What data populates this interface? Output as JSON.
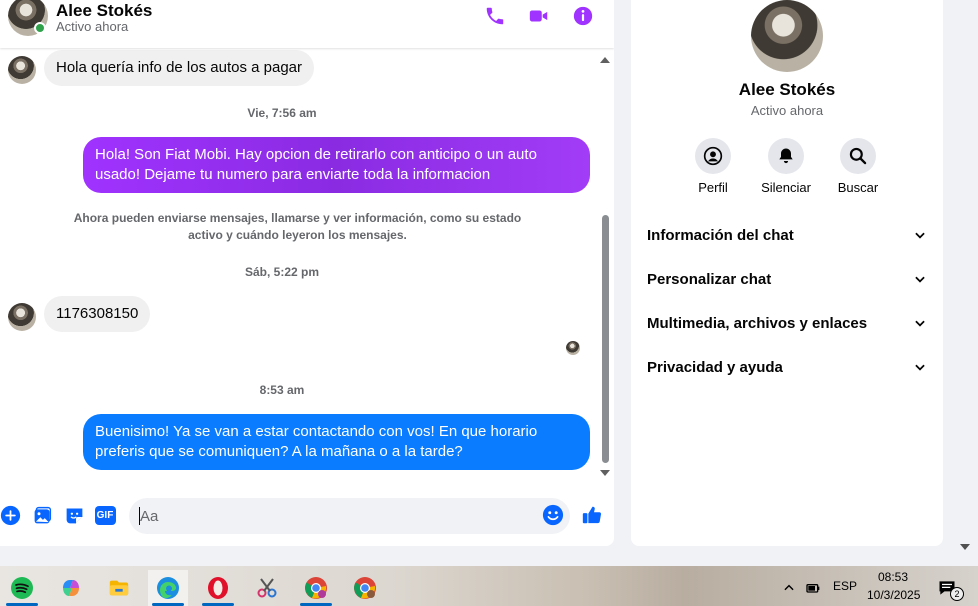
{
  "header": {
    "name": "Alee Stokés",
    "status": "Activo ahora"
  },
  "messages": [
    {
      "type": "incoming",
      "text": "Hola quería info de los autos a pagar"
    },
    {
      "type": "time",
      "text": "Vie, 7:56 am"
    },
    {
      "type": "outgoing",
      "text": "Hola! Son Fiat Mobi. Hay opcion de retirarlo con anticipo o un auto usado! Dejame tu numero para enviarte toda la informacion"
    },
    {
      "type": "notice",
      "text": "Ahora pueden enviarse mensajes, llamarse y ver información, como su estado activo y cuándo leyeron los mensajes."
    },
    {
      "type": "time",
      "text": "Sáb, 5:22 pm"
    },
    {
      "type": "incoming",
      "text": "1176308150"
    },
    {
      "type": "time",
      "text": "8:53 am"
    },
    {
      "type": "outgoing",
      "text": "Buenisimo! Ya se van a estar contactando con vos! En que horario preferis que se comuniquen? A la mañana o a la tarde?"
    }
  ],
  "composer": {
    "placeholder": "Aa",
    "gif_label": "GIF"
  },
  "info_panel": {
    "name": "Alee Stokés",
    "status": "Activo ahora",
    "actions": [
      {
        "label": "Perfil",
        "icon": "profile-icon"
      },
      {
        "label": "Silenciar",
        "icon": "bell-icon"
      },
      {
        "label": "Buscar",
        "icon": "search-icon"
      }
    ],
    "sections": [
      {
        "label": "Información del chat"
      },
      {
        "label": "Personalizar chat"
      },
      {
        "label": "Multimedia, archivos y enlaces"
      },
      {
        "label": "Privacidad y ayuda"
      }
    ]
  },
  "taskbar": {
    "language": "ESP",
    "time": "08:53",
    "date": "10/3/2025",
    "notification_count": "2"
  },
  "colors": {
    "accent": "#a033ff",
    "outgoing_blue": "#0a7cff",
    "online": "#31a24c",
    "composer_blue": "#0866ff"
  }
}
